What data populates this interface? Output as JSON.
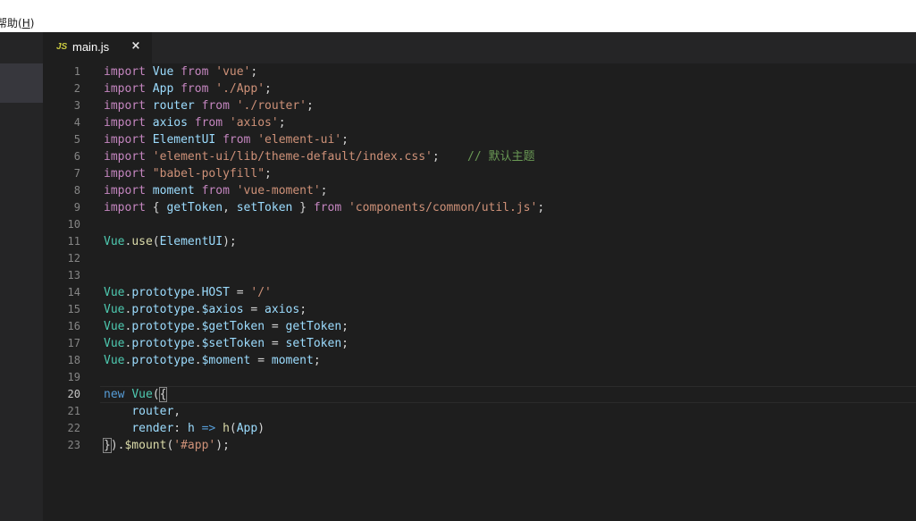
{
  "menu": {
    "help_partial": "帮助(",
    "help_key": "H",
    "help_end": ")"
  },
  "tab": {
    "icon": "JS",
    "label": "main.js",
    "close": "×"
  },
  "editor": {
    "active_line": 20
  },
  "code_lines": [
    [
      {
        "t": "kw",
        "v": "import"
      },
      {
        "t": "pn",
        "v": " "
      },
      {
        "t": "id",
        "v": "Vue"
      },
      {
        "t": "pn",
        "v": " "
      },
      {
        "t": "kw",
        "v": "from"
      },
      {
        "t": "pn",
        "v": " "
      },
      {
        "t": "str",
        "v": "'vue'"
      },
      {
        "t": "pn",
        "v": ";"
      }
    ],
    [
      {
        "t": "kw",
        "v": "import"
      },
      {
        "t": "pn",
        "v": " "
      },
      {
        "t": "id",
        "v": "App"
      },
      {
        "t": "pn",
        "v": " "
      },
      {
        "t": "kw",
        "v": "from"
      },
      {
        "t": "pn",
        "v": " "
      },
      {
        "t": "str",
        "v": "'./App'"
      },
      {
        "t": "pn",
        "v": ";"
      }
    ],
    [
      {
        "t": "kw",
        "v": "import"
      },
      {
        "t": "pn",
        "v": " "
      },
      {
        "t": "id",
        "v": "router"
      },
      {
        "t": "pn",
        "v": " "
      },
      {
        "t": "kw",
        "v": "from"
      },
      {
        "t": "pn",
        "v": " "
      },
      {
        "t": "str",
        "v": "'./router'"
      },
      {
        "t": "pn",
        "v": ";"
      }
    ],
    [
      {
        "t": "kw",
        "v": "import"
      },
      {
        "t": "pn",
        "v": " "
      },
      {
        "t": "id",
        "v": "axios"
      },
      {
        "t": "pn",
        "v": " "
      },
      {
        "t": "kw",
        "v": "from"
      },
      {
        "t": "pn",
        "v": " "
      },
      {
        "t": "str",
        "v": "'axios'"
      },
      {
        "t": "pn",
        "v": ";"
      }
    ],
    [
      {
        "t": "kw",
        "v": "import"
      },
      {
        "t": "pn",
        "v": " "
      },
      {
        "t": "id",
        "v": "ElementUI"
      },
      {
        "t": "pn",
        "v": " "
      },
      {
        "t": "kw",
        "v": "from"
      },
      {
        "t": "pn",
        "v": " "
      },
      {
        "t": "str",
        "v": "'element-ui'"
      },
      {
        "t": "pn",
        "v": ";"
      }
    ],
    [
      {
        "t": "kw",
        "v": "import"
      },
      {
        "t": "pn",
        "v": " "
      },
      {
        "t": "str",
        "v": "'element-ui/lib/theme-default/index.css'"
      },
      {
        "t": "pn",
        "v": ";    "
      },
      {
        "t": "cm",
        "v": "// 默认主题"
      }
    ],
    [
      {
        "t": "kw",
        "v": "import"
      },
      {
        "t": "pn",
        "v": " "
      },
      {
        "t": "str",
        "v": "\"babel-polyfill\""
      },
      {
        "t": "pn",
        "v": ";"
      }
    ],
    [
      {
        "t": "kw",
        "v": "import"
      },
      {
        "t": "pn",
        "v": " "
      },
      {
        "t": "id",
        "v": "moment"
      },
      {
        "t": "pn",
        "v": " "
      },
      {
        "t": "kw",
        "v": "from"
      },
      {
        "t": "pn",
        "v": " "
      },
      {
        "t": "str",
        "v": "'vue-moment'"
      },
      {
        "t": "pn",
        "v": ";"
      }
    ],
    [
      {
        "t": "kw",
        "v": "import"
      },
      {
        "t": "pn",
        "v": " { "
      },
      {
        "t": "id",
        "v": "getToken"
      },
      {
        "t": "pn",
        "v": ", "
      },
      {
        "t": "id",
        "v": "setToken"
      },
      {
        "t": "pn",
        "v": " } "
      },
      {
        "t": "kw",
        "v": "from"
      },
      {
        "t": "pn",
        "v": " "
      },
      {
        "t": "str",
        "v": "'components/common/util.js'"
      },
      {
        "t": "pn",
        "v": ";"
      }
    ],
    [],
    [
      {
        "t": "cls",
        "v": "Vue"
      },
      {
        "t": "pn",
        "v": "."
      },
      {
        "t": "fn",
        "v": "use"
      },
      {
        "t": "pn",
        "v": "("
      },
      {
        "t": "id",
        "v": "ElementUI"
      },
      {
        "t": "pn",
        "v": ");"
      }
    ],
    [],
    [],
    [
      {
        "t": "cls",
        "v": "Vue"
      },
      {
        "t": "pn",
        "v": "."
      },
      {
        "t": "id",
        "v": "prototype"
      },
      {
        "t": "pn",
        "v": "."
      },
      {
        "t": "id",
        "v": "HOST"
      },
      {
        "t": "pn",
        "v": " = "
      },
      {
        "t": "str",
        "v": "'/'"
      }
    ],
    [
      {
        "t": "cls",
        "v": "Vue"
      },
      {
        "t": "pn",
        "v": "."
      },
      {
        "t": "id",
        "v": "prototype"
      },
      {
        "t": "pn",
        "v": "."
      },
      {
        "t": "id",
        "v": "$axios"
      },
      {
        "t": "pn",
        "v": " = "
      },
      {
        "t": "id",
        "v": "axios"
      },
      {
        "t": "pn",
        "v": ";"
      }
    ],
    [
      {
        "t": "cls",
        "v": "Vue"
      },
      {
        "t": "pn",
        "v": "."
      },
      {
        "t": "id",
        "v": "prototype"
      },
      {
        "t": "pn",
        "v": "."
      },
      {
        "t": "id",
        "v": "$getToken"
      },
      {
        "t": "pn",
        "v": " = "
      },
      {
        "t": "id",
        "v": "getToken"
      },
      {
        "t": "pn",
        "v": ";"
      }
    ],
    [
      {
        "t": "cls",
        "v": "Vue"
      },
      {
        "t": "pn",
        "v": "."
      },
      {
        "t": "id",
        "v": "prototype"
      },
      {
        "t": "pn",
        "v": "."
      },
      {
        "t": "id",
        "v": "$setToken"
      },
      {
        "t": "pn",
        "v": " = "
      },
      {
        "t": "id",
        "v": "setToken"
      },
      {
        "t": "pn",
        "v": ";"
      }
    ],
    [
      {
        "t": "cls",
        "v": "Vue"
      },
      {
        "t": "pn",
        "v": "."
      },
      {
        "t": "id",
        "v": "prototype"
      },
      {
        "t": "pn",
        "v": "."
      },
      {
        "t": "id",
        "v": "$moment"
      },
      {
        "t": "pn",
        "v": " = "
      },
      {
        "t": "id",
        "v": "moment"
      },
      {
        "t": "pn",
        "v": ";"
      }
    ],
    [],
    [
      {
        "t": "kb",
        "v": "new"
      },
      {
        "t": "pn",
        "v": " "
      },
      {
        "t": "cls",
        "v": "Vue"
      },
      {
        "t": "pn",
        "v": "("
      },
      {
        "t": "pn bracket",
        "v": "{"
      }
    ],
    [
      {
        "t": "pn",
        "v": "    "
      },
      {
        "t": "id",
        "v": "router"
      },
      {
        "t": "pn",
        "v": ","
      }
    ],
    [
      {
        "t": "pn",
        "v": "    "
      },
      {
        "t": "id",
        "v": "render"
      },
      {
        "t": "pn",
        "v": ": "
      },
      {
        "t": "id",
        "v": "h"
      },
      {
        "t": "pn",
        "v": " "
      },
      {
        "t": "kb",
        "v": "=>"
      },
      {
        "t": "pn",
        "v": " "
      },
      {
        "t": "fn",
        "v": "h"
      },
      {
        "t": "pn",
        "v": "("
      },
      {
        "t": "id",
        "v": "App"
      },
      {
        "t": "pn",
        "v": ")"
      }
    ],
    [
      {
        "t": "pn bracket",
        "v": "}"
      },
      {
        "t": "pn",
        "v": ")."
      },
      {
        "t": "fn",
        "v": "$mount"
      },
      {
        "t": "pn",
        "v": "("
      },
      {
        "t": "str",
        "v": "'#app'"
      },
      {
        "t": "pn",
        "v": ");"
      }
    ]
  ]
}
